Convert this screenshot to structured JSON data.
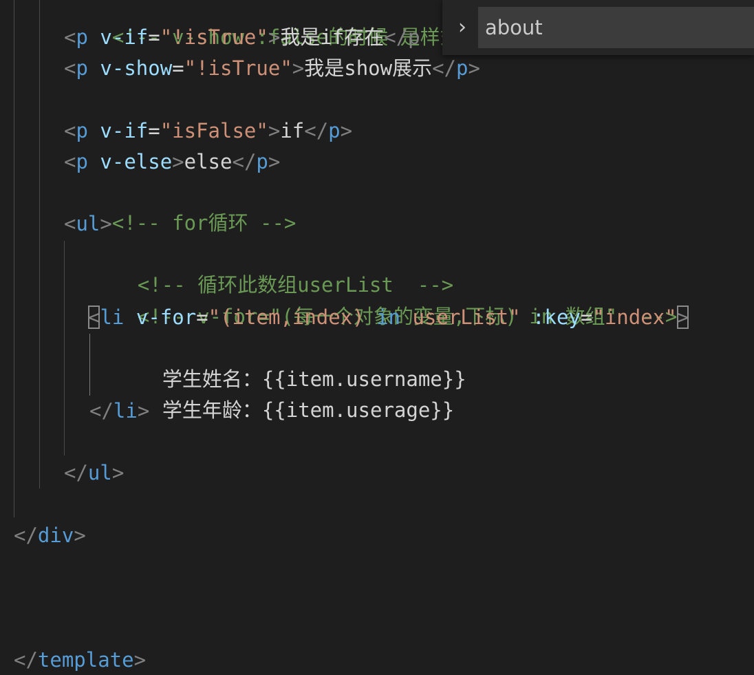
{
  "code": {
    "l0": {
      "text": "<!-- v-show :false的时候 是样式"
    },
    "l1": {
      "lt": "<",
      "tag": "p",
      "attr": "v-if",
      "eq": "=",
      "val": "\"!isTrue\"",
      "gt": ">",
      "content": "我是if存在",
      "close": "</p"
    },
    "l2": {
      "lt": "<",
      "tag": "p",
      "attr": "v-show",
      "eq": "=",
      "val": "\"!isTrue\"",
      "gt": ">",
      "content": "我是show展示",
      "close_lt": "</",
      "close_tag": "p",
      "close_gt": ">"
    },
    "l4": {
      "lt": "<",
      "tag": "p",
      "attr": "v-if",
      "eq": "=",
      "val": "\"isFalse\"",
      "gt": ">",
      "content": "if",
      "close_lt": "</",
      "close_tag": "p",
      "close_gt": ">"
    },
    "l5": {
      "lt": "<",
      "tag": "p",
      "attr": "v-else",
      "gt": ">",
      "content": "else",
      "close_lt": "</",
      "close_tag": "p",
      "close_gt": ">"
    },
    "l6": {
      "text": "<!-- for循环 -->"
    },
    "l7": {
      "lt": "<",
      "tag": "ul",
      "gt": ">"
    },
    "l8": {
      "text": "<!-- 循环此数组userList  -->"
    },
    "l9": {
      "text": "<!-- v-for=\"(每一个对象的变量,下标) in 数组\"  -->"
    },
    "l10": {
      "lt": "<",
      "tag": "li",
      "attr": "v-for",
      "eq": "=",
      "val_open": "\"(item,index) ",
      "val_kw": "in",
      "val_close": " userList\"",
      "attr2": ":key",
      "eq2": "=",
      "val2": "\"index\"",
      "gt": ">"
    },
    "l11": {
      "content": "学生姓名：{{item.username}}"
    },
    "l12": {
      "content": "学生年龄：{{item.userage}}"
    },
    "l13": {
      "lt": "</",
      "tag": "li",
      "gt": ">"
    },
    "l15": {
      "lt": "</",
      "tag": "ul",
      "gt": ">"
    },
    "l17": {
      "lt": "</",
      "tag": "div",
      "gt": ">"
    },
    "l21": {
      "lt": "</",
      "tag": "template",
      "gt": ">"
    }
  },
  "find_widget": {
    "toggle_icon": "chevron-right-icon",
    "toggle_glyph": "›",
    "search_value": "about"
  }
}
